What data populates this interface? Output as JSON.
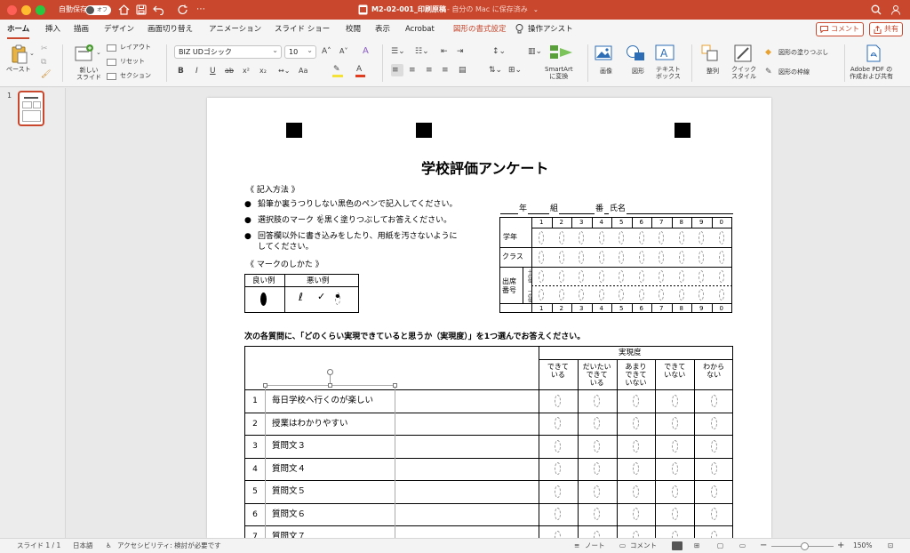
{
  "titlebar": {
    "autosave_label": "自動保存",
    "autosave_state": "オフ",
    "doc_title": "M2-02-001_印刷原稿",
    "save_status": " - 自分の Mac に保存済み",
    "more_label": "⋯"
  },
  "menu": {
    "tabs": [
      "ホーム",
      "挿入",
      "描画",
      "デザイン",
      "画面切り替え",
      "アニメーション",
      "スライド ショー",
      "校閲",
      "表示",
      "Acrobat",
      "図形の書式設定"
    ],
    "assist": "操作アシスト",
    "comment_btn": "コメント",
    "share_btn": "共有"
  },
  "ribbon": {
    "paste": "ペースト",
    "new_slide": "新しい\nスライド",
    "layout": "レイアウト",
    "reset": "リセット",
    "section": "セクション",
    "font_name": "BIZ UDゴシック",
    "font_size": "10",
    "smartart": "SmartArt\nに変換",
    "image": "画像",
    "shape": "図形",
    "textbox": "テキスト\nボックス",
    "arrange": "整列",
    "quick_style": "クイック\nスタイル",
    "shape_fill": "図形の塗りつぶし",
    "shape_outline": "図形の枠線",
    "adobe": "Adobe PDF の\n作成および共有",
    "fmt": [
      "B",
      "I",
      "U",
      "ab",
      "x²",
      "x₂",
      "Aa",
      "A",
      "A"
    ]
  },
  "thumbs": {
    "slide_number": "1"
  },
  "slide": {
    "title": "学校評価アンケート",
    "instructions_header": "《 記入方法 》",
    "bullets": [
      "鉛筆か裏うつりしない黒色のペンで記入してください。",
      "選択肢のマーク  を黒く塗りつぶしてお答えください。",
      "回答欄以外に書き込みをしたり、用紙を汚さないように",
      "してください。"
    ],
    "mark_header": "《 マークのしかた 》",
    "good_label": "良い例",
    "bad_label": "悪い例",
    "name_row": {
      "year": "年",
      "class": "組",
      "number": "番",
      "name": "氏名"
    },
    "digits": [
      "1",
      "2",
      "3",
      "4",
      "5",
      "6",
      "7",
      "8",
      "9",
      "0"
    ],
    "grid_rows": {
      "grade": "学年",
      "cls": "クラス",
      "seat": "出席\n番号",
      "tens": "十の位",
      "ones": "一の位"
    },
    "question_lead": "次の各質問に、「どのくらい実現できていると思うか（実現度）」を1つ選んでお答えください。",
    "degree_header": "実現度",
    "choices": [
      "できて\nいる",
      "だいたい\nできて\nいる",
      "あまり\nできて\nいない",
      "できて\nいない",
      "わから\nない"
    ],
    "questions": [
      {
        "no": "1",
        "text": "毎日学校へ行くのが楽しい"
      },
      {
        "no": "2",
        "text": "授業はわかりやすい"
      },
      {
        "no": "3",
        "text": "質問文３"
      },
      {
        "no": "4",
        "text": "質問文４"
      },
      {
        "no": "5",
        "text": "質問文５"
      },
      {
        "no": "6",
        "text": "質問文６"
      },
      {
        "no": "7",
        "text": "質問文７"
      }
    ]
  },
  "status": {
    "slide_info": "スライド 1 / 1",
    "language": "日本語",
    "accessibility": "アクセシビリティ: 検討が必要です",
    "notes": "ノート",
    "comments": "コメント",
    "zoom": "150%"
  },
  "colors": {
    "accent": "#c8472d",
    "ribbon_bg": "#f5f5f5",
    "canvas_bg": "#e9e9e9"
  }
}
